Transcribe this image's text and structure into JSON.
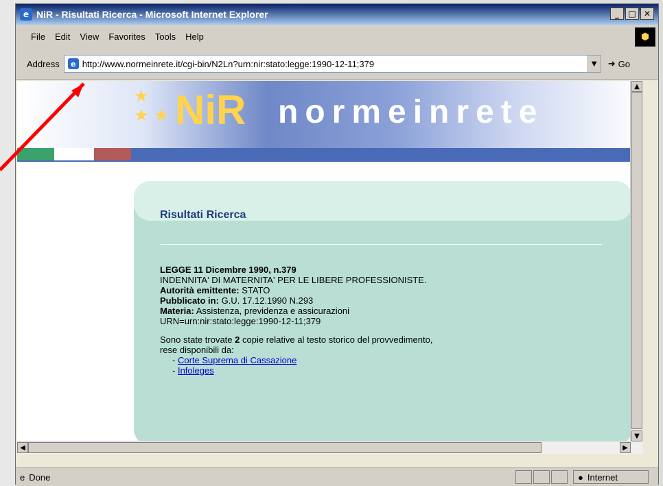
{
  "window": {
    "title": "NiR - Risultati Ricerca - Microsoft Internet Explorer",
    "controls": [
      "_",
      "□",
      "✕"
    ]
  },
  "menu": [
    "File",
    "Edit",
    "View",
    "Favorites",
    "Tools",
    "Help"
  ],
  "address": {
    "label": "Address",
    "url": "http://www.normeinrete.it/cgi-bin/N2Ln?urn:nir:stato:legge:1990-12-11;379",
    "go": "Go"
  },
  "banner": {
    "logo_text": "normeinrete"
  },
  "results": {
    "title": "Risultati Ricerca",
    "doc_title": "LEGGE 11 Dicembre 1990, n.379",
    "subtitle": "INDENNITA' DI MATERNITA' PER LE LIBERE PROFESSIONISTE.",
    "authority_label": "Autorità emittente:",
    "authority_value": "STATO",
    "published_label": "Pubblicato in:",
    "published_value": "G.U. 17.12.1990 N.293",
    "subject_label": "Materia:",
    "subject_value": "Assistenza, previdenza e assicurazioni",
    "urn": "URN=urn:nir:stato:legge:1990-12-11;379",
    "found_text_1": "Sono state trovate",
    "found_count": "2",
    "found_text_2": "copie relative al testo storico del provvedimento,",
    "available_text": "rese disponibili da:",
    "links": [
      {
        "label": "Corte Suprema di Cassazione"
      },
      {
        "label": "Infoleges"
      }
    ]
  },
  "status": {
    "left": "Done",
    "zone": "Internet"
  },
  "colors": {
    "banner_blue": "#496ab6",
    "card_green": "#b9dfd5",
    "card_light": "#d9f0e9",
    "link_blue": "#0000cc",
    "arrow_red": "#ff0000"
  }
}
